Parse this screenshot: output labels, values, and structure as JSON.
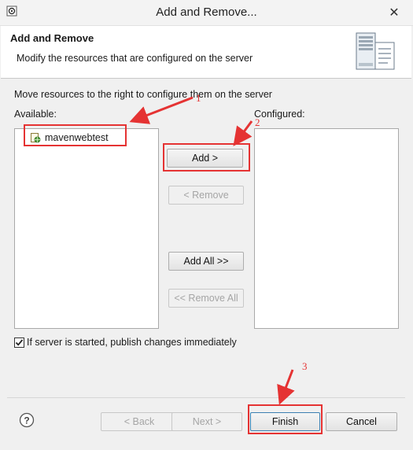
{
  "window": {
    "title": "Add and Remove...",
    "close_glyph": "✕"
  },
  "banner": {
    "title": "Add and Remove",
    "description": "Modify the resources that are configured on the server",
    "icon": "server-icon"
  },
  "main": {
    "instruction": "Move resources to the right to configure them on the server",
    "available_label": "Available:",
    "configured_label": "Configured:",
    "available_items": [
      {
        "label": "mavenwebtest",
        "icon": "web-project-icon"
      }
    ],
    "configured_items": []
  },
  "buttons": {
    "add": "Add >",
    "remove": "< Remove",
    "add_all": "Add All >>",
    "remove_all": "<< Remove All"
  },
  "options": {
    "publish_checkbox_label": "If server is started, publish changes immediately",
    "publish_checked": true
  },
  "footer": {
    "help_icon": "help-icon",
    "back": "< Back",
    "next": "Next >",
    "finish": "Finish",
    "cancel": "Cancel"
  },
  "annotations": {
    "step1": "1",
    "step2": "2",
    "step3": "3",
    "highlight_color": "#e53333"
  }
}
